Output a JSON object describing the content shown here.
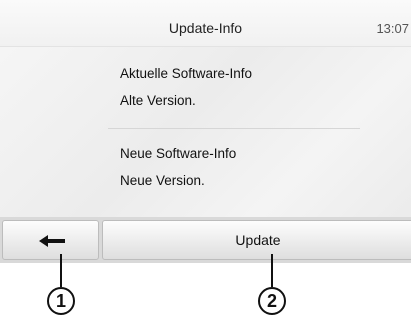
{
  "header": {
    "title": "Update-Info",
    "clock": "13:07"
  },
  "info": {
    "current_label": "Aktuelle Software-Info",
    "current_value": "Alte Version.",
    "new_label": "Neue Software-Info",
    "new_value": "Neue Version."
  },
  "buttons": {
    "back_icon": "back-arrow-icon",
    "update_label": "Update"
  },
  "callouts": [
    "1",
    "2"
  ],
  "colors": {
    "button_bar": "#d9d9d9",
    "text": "#111111"
  }
}
